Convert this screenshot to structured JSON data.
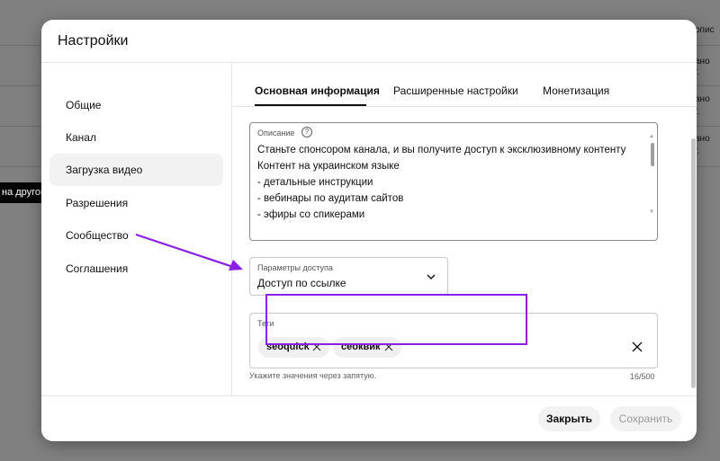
{
  "background": {
    "right_fragments": [
      "опис",
      "ано",
      "г.",
      "ано",
      "г.",
      "ано",
      "г."
    ],
    "left_label": "на другом"
  },
  "dialog": {
    "title": "Настройки",
    "sidebar": [
      {
        "label": "Общие",
        "active": false
      },
      {
        "label": "Канал",
        "active": false
      },
      {
        "label": "Загрузка видео",
        "active": true
      },
      {
        "label": "Разрешения",
        "active": false
      },
      {
        "label": "Сообщество",
        "active": false
      },
      {
        "label": "Соглашения",
        "active": false
      }
    ],
    "tabs": [
      {
        "label": "Основная информация",
        "active": true
      },
      {
        "label": "Расширенные настройки",
        "active": false
      },
      {
        "label": "Монетизация",
        "active": false
      }
    ],
    "description": {
      "label": "Описание",
      "help_icon": "question-circle-icon",
      "lines": [
        "Станьте спонсором канала, и вы получите доступ к эксклюзивному контенту",
        "Контент на украинском языке",
        "- детальные инструкции",
        "- вебинары по аудитам сайтов",
        "- эфиры со спикерами"
      ]
    },
    "access": {
      "label": "Параметры доступа",
      "value": "Доступ по ссылке",
      "icon": "chevron-down-icon"
    },
    "tags": {
      "label": "Теги",
      "chips": [
        "seoquick",
        "сеоквик"
      ],
      "hint": "Укажите значения через запятую.",
      "count": "16/500"
    },
    "footer": {
      "close_label": "Закрыть",
      "save_label": "Сохранить"
    }
  },
  "annotation": {
    "highlight_color": "#8a20e6"
  }
}
